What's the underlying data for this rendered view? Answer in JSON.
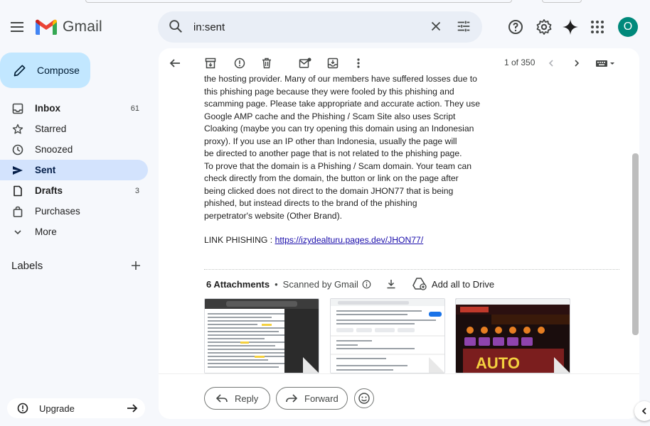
{
  "app": {
    "name": "Gmail"
  },
  "search": {
    "query": "in:sent"
  },
  "account": {
    "avatar_letter": "O",
    "avatar_color": "#00897b"
  },
  "sidebar": {
    "compose_label": "Compose",
    "items": [
      {
        "label": "Inbox",
        "count": "61",
        "icon": "inbox-icon",
        "bold": true
      },
      {
        "label": "Starred",
        "count": "",
        "icon": "star-icon",
        "bold": false
      },
      {
        "label": "Snoozed",
        "count": "",
        "icon": "clock-icon",
        "bold": false
      },
      {
        "label": "Sent",
        "count": "",
        "icon": "send-icon",
        "bold": true,
        "active": true
      },
      {
        "label": "Drafts",
        "count": "3",
        "icon": "draft-icon",
        "bold": true
      },
      {
        "label": "Purchases",
        "count": "",
        "icon": "bag-icon",
        "bold": false
      },
      {
        "label": "More",
        "count": "",
        "icon": "chevron-down-icon",
        "bold": false
      }
    ],
    "labels_title": "Labels",
    "upgrade_label": "Upgrade"
  },
  "toolbar": {
    "pager": "1 of 350"
  },
  "message": {
    "lines": [
      "the hosting provider. Many of our members have suffered losses due to",
      "this phishing page because they were fooled by this phishing and",
      "scamming page. Please take appropriate and accurate action. They use",
      "Google AMP cache and the Phishing / Scam Site also uses Script",
      "Cloaking (maybe you can try opening this domain using an Indonesian",
      "proxy). If you use an IP other than Indonesia, usually the page will",
      "be directed to another page that is not related to the phishing page.",
      "To prove that the domain is a Phishing / Scam domain. Your team can",
      "check directly from the domain, the button or link on the page after",
      "being clicked does not direct to the domain JHON77 that is being",
      "phished, but instead directs to the brand of the phishing",
      "perpetrator's website (Other Brand)."
    ],
    "link_prefix": "LINK PHISHING : ",
    "link_url": "https://izydealturu.pages.dev/JHON77/"
  },
  "attachments": {
    "count_label": "6 Attachments",
    "scanned_label": "Scanned by Gmail",
    "add_drive_label": "Add all to Drive",
    "thumb3_brand": "AUTO"
  },
  "actions": {
    "reply_label": "Reply",
    "forward_label": "Forward"
  },
  "colors": {
    "compose_bg": "#c2e7ff",
    "active_nav_bg": "#d3e3fd",
    "link": "#1a0dab",
    "app_bg": "#f6f8fc"
  }
}
